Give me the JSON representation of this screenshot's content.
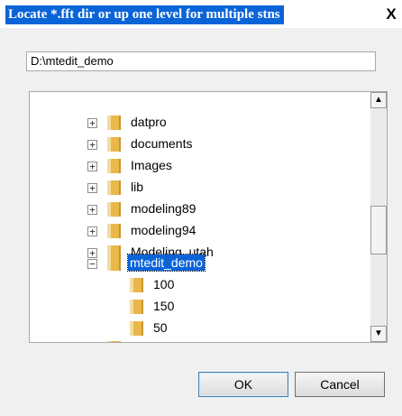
{
  "window": {
    "title": "Locate *.fft dir or up one level for multiple stns",
    "close_label": "X"
  },
  "path_field": {
    "value": "D:\\mtedit_demo"
  },
  "tree": {
    "items": [
      {
        "label": "datpro",
        "expander": "+"
      },
      {
        "label": "documents",
        "expander": "+"
      },
      {
        "label": "Images",
        "expander": "+"
      },
      {
        "label": "lib",
        "expander": "+"
      },
      {
        "label": "modeling89",
        "expander": "+"
      },
      {
        "label": "modeling94",
        "expander": "+"
      },
      {
        "label": "Modeling_utah",
        "expander": "+"
      },
      {
        "label": "mtedit_demo",
        "expander": "−",
        "selected": true
      },
      {
        "label": "100"
      },
      {
        "label": "150"
      },
      {
        "label": "50"
      }
    ],
    "scroll_up": "▲",
    "scroll_down": "▼"
  },
  "buttons": {
    "ok": "OK",
    "cancel": "Cancel"
  },
  "colors": {
    "selection": "#0a64d8",
    "folder": "#e8b84a",
    "dialog_bg": "#f0f0f0"
  }
}
